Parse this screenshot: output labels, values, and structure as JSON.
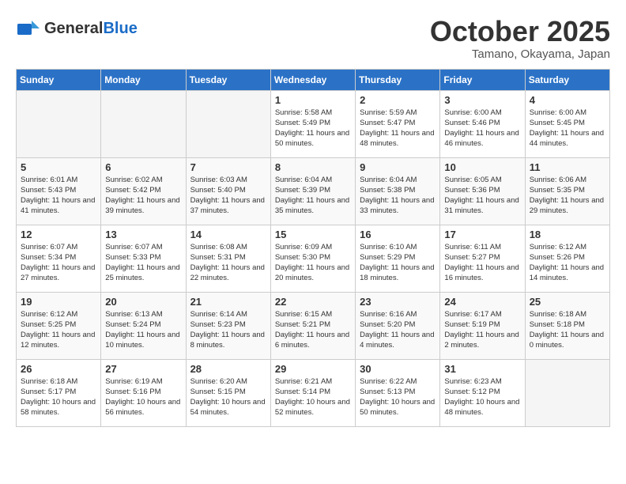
{
  "logo": {
    "general": "General",
    "blue": "Blue"
  },
  "title": "October 2025",
  "location": "Tamano, Okayama, Japan",
  "weekdays": [
    "Sunday",
    "Monday",
    "Tuesday",
    "Wednesday",
    "Thursday",
    "Friday",
    "Saturday"
  ],
  "weeks": [
    [
      {
        "day": "",
        "empty": true
      },
      {
        "day": "",
        "empty": true
      },
      {
        "day": "",
        "empty": true
      },
      {
        "day": "1",
        "sunrise": "Sunrise: 5:58 AM",
        "sunset": "Sunset: 5:49 PM",
        "daylight": "Daylight: 11 hours and 50 minutes."
      },
      {
        "day": "2",
        "sunrise": "Sunrise: 5:59 AM",
        "sunset": "Sunset: 5:47 PM",
        "daylight": "Daylight: 11 hours and 48 minutes."
      },
      {
        "day": "3",
        "sunrise": "Sunrise: 6:00 AM",
        "sunset": "Sunset: 5:46 PM",
        "daylight": "Daylight: 11 hours and 46 minutes."
      },
      {
        "day": "4",
        "sunrise": "Sunrise: 6:00 AM",
        "sunset": "Sunset: 5:45 PM",
        "daylight": "Daylight: 11 hours and 44 minutes."
      }
    ],
    [
      {
        "day": "5",
        "sunrise": "Sunrise: 6:01 AM",
        "sunset": "Sunset: 5:43 PM",
        "daylight": "Daylight: 11 hours and 41 minutes."
      },
      {
        "day": "6",
        "sunrise": "Sunrise: 6:02 AM",
        "sunset": "Sunset: 5:42 PM",
        "daylight": "Daylight: 11 hours and 39 minutes."
      },
      {
        "day": "7",
        "sunrise": "Sunrise: 6:03 AM",
        "sunset": "Sunset: 5:40 PM",
        "daylight": "Daylight: 11 hours and 37 minutes."
      },
      {
        "day": "8",
        "sunrise": "Sunrise: 6:04 AM",
        "sunset": "Sunset: 5:39 PM",
        "daylight": "Daylight: 11 hours and 35 minutes."
      },
      {
        "day": "9",
        "sunrise": "Sunrise: 6:04 AM",
        "sunset": "Sunset: 5:38 PM",
        "daylight": "Daylight: 11 hours and 33 minutes."
      },
      {
        "day": "10",
        "sunrise": "Sunrise: 6:05 AM",
        "sunset": "Sunset: 5:36 PM",
        "daylight": "Daylight: 11 hours and 31 minutes."
      },
      {
        "day": "11",
        "sunrise": "Sunrise: 6:06 AM",
        "sunset": "Sunset: 5:35 PM",
        "daylight": "Daylight: 11 hours and 29 minutes."
      }
    ],
    [
      {
        "day": "12",
        "sunrise": "Sunrise: 6:07 AM",
        "sunset": "Sunset: 5:34 PM",
        "daylight": "Daylight: 11 hours and 27 minutes."
      },
      {
        "day": "13",
        "sunrise": "Sunrise: 6:07 AM",
        "sunset": "Sunset: 5:33 PM",
        "daylight": "Daylight: 11 hours and 25 minutes."
      },
      {
        "day": "14",
        "sunrise": "Sunrise: 6:08 AM",
        "sunset": "Sunset: 5:31 PM",
        "daylight": "Daylight: 11 hours and 22 minutes."
      },
      {
        "day": "15",
        "sunrise": "Sunrise: 6:09 AM",
        "sunset": "Sunset: 5:30 PM",
        "daylight": "Daylight: 11 hours and 20 minutes."
      },
      {
        "day": "16",
        "sunrise": "Sunrise: 6:10 AM",
        "sunset": "Sunset: 5:29 PM",
        "daylight": "Daylight: 11 hours and 18 minutes."
      },
      {
        "day": "17",
        "sunrise": "Sunrise: 6:11 AM",
        "sunset": "Sunset: 5:27 PM",
        "daylight": "Daylight: 11 hours and 16 minutes."
      },
      {
        "day": "18",
        "sunrise": "Sunrise: 6:12 AM",
        "sunset": "Sunset: 5:26 PM",
        "daylight": "Daylight: 11 hours and 14 minutes."
      }
    ],
    [
      {
        "day": "19",
        "sunrise": "Sunrise: 6:12 AM",
        "sunset": "Sunset: 5:25 PM",
        "daylight": "Daylight: 11 hours and 12 minutes."
      },
      {
        "day": "20",
        "sunrise": "Sunrise: 6:13 AM",
        "sunset": "Sunset: 5:24 PM",
        "daylight": "Daylight: 11 hours and 10 minutes."
      },
      {
        "day": "21",
        "sunrise": "Sunrise: 6:14 AM",
        "sunset": "Sunset: 5:23 PM",
        "daylight": "Daylight: 11 hours and 8 minutes."
      },
      {
        "day": "22",
        "sunrise": "Sunrise: 6:15 AM",
        "sunset": "Sunset: 5:21 PM",
        "daylight": "Daylight: 11 hours and 6 minutes."
      },
      {
        "day": "23",
        "sunrise": "Sunrise: 6:16 AM",
        "sunset": "Sunset: 5:20 PM",
        "daylight": "Daylight: 11 hours and 4 minutes."
      },
      {
        "day": "24",
        "sunrise": "Sunrise: 6:17 AM",
        "sunset": "Sunset: 5:19 PM",
        "daylight": "Daylight: 11 hours and 2 minutes."
      },
      {
        "day": "25",
        "sunrise": "Sunrise: 6:18 AM",
        "sunset": "Sunset: 5:18 PM",
        "daylight": "Daylight: 11 hours and 0 minutes."
      }
    ],
    [
      {
        "day": "26",
        "sunrise": "Sunrise: 6:18 AM",
        "sunset": "Sunset: 5:17 PM",
        "daylight": "Daylight: 10 hours and 58 minutes."
      },
      {
        "day": "27",
        "sunrise": "Sunrise: 6:19 AM",
        "sunset": "Sunset: 5:16 PM",
        "daylight": "Daylight: 10 hours and 56 minutes."
      },
      {
        "day": "28",
        "sunrise": "Sunrise: 6:20 AM",
        "sunset": "Sunset: 5:15 PM",
        "daylight": "Daylight: 10 hours and 54 minutes."
      },
      {
        "day": "29",
        "sunrise": "Sunrise: 6:21 AM",
        "sunset": "Sunset: 5:14 PM",
        "daylight": "Daylight: 10 hours and 52 minutes."
      },
      {
        "day": "30",
        "sunrise": "Sunrise: 6:22 AM",
        "sunset": "Sunset: 5:13 PM",
        "daylight": "Daylight: 10 hours and 50 minutes."
      },
      {
        "day": "31",
        "sunrise": "Sunrise: 6:23 AM",
        "sunset": "Sunset: 5:12 PM",
        "daylight": "Daylight: 10 hours and 48 minutes."
      },
      {
        "day": "",
        "empty": true
      }
    ]
  ]
}
